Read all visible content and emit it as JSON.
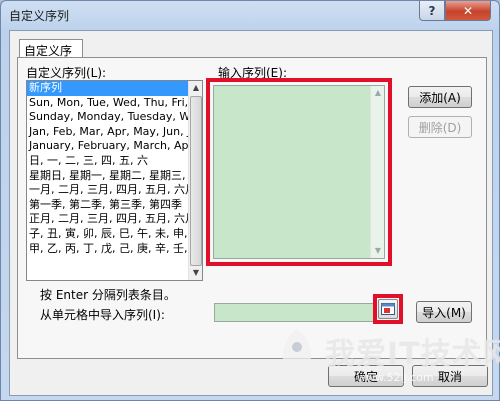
{
  "window": {
    "title": "自定义序列",
    "help_symbol": "?",
    "close_symbol": "✕"
  },
  "tab": {
    "label": "自定义序列"
  },
  "custom_lists": {
    "label": "自定义序列(L):",
    "items": [
      "新序列",
      "Sun, Mon, Tue, Wed, Thu, Fri, S",
      "Sunday, Monday, Tuesday, Wed",
      "Jan, Feb, Mar, Apr, May, Jun, Ju",
      "January, February, March, April",
      "日, 一, 二, 三, 四, 五, 六",
      "星期日, 星期一, 星期二, 星期三, 星",
      "一月, 二月, 三月, 四月, 五月, 六月, ",
      "第一季, 第二季, 第三季, 第四季",
      "正月, 二月, 三月, 四月, 五月, 六月, ",
      "子, 丑, 寅, 卯, 辰, 巳, 午, 未, 申, 酉",
      "甲, 乙, 丙, 丁, 戊, 己, 庚, 辛, 壬, 癸"
    ],
    "selected_index": 0
  },
  "entries": {
    "label": "输入序列(E):",
    "value": ""
  },
  "buttons": {
    "add": "添加(A)",
    "delete": "删除(D)",
    "import": "导入(M)",
    "ok": "确定",
    "cancel": "取消"
  },
  "hint": "按 Enter 分隔列表条目。",
  "import_range": {
    "label": "从单元格中导入序列(I):",
    "value": ""
  },
  "watermark": {
    "text": "我爱IT技术网",
    "url": "www.52ij.com"
  },
  "colors": {
    "highlight": "#e0102a",
    "input_fill": "#c8e6c9",
    "selection": "#3399ff"
  }
}
